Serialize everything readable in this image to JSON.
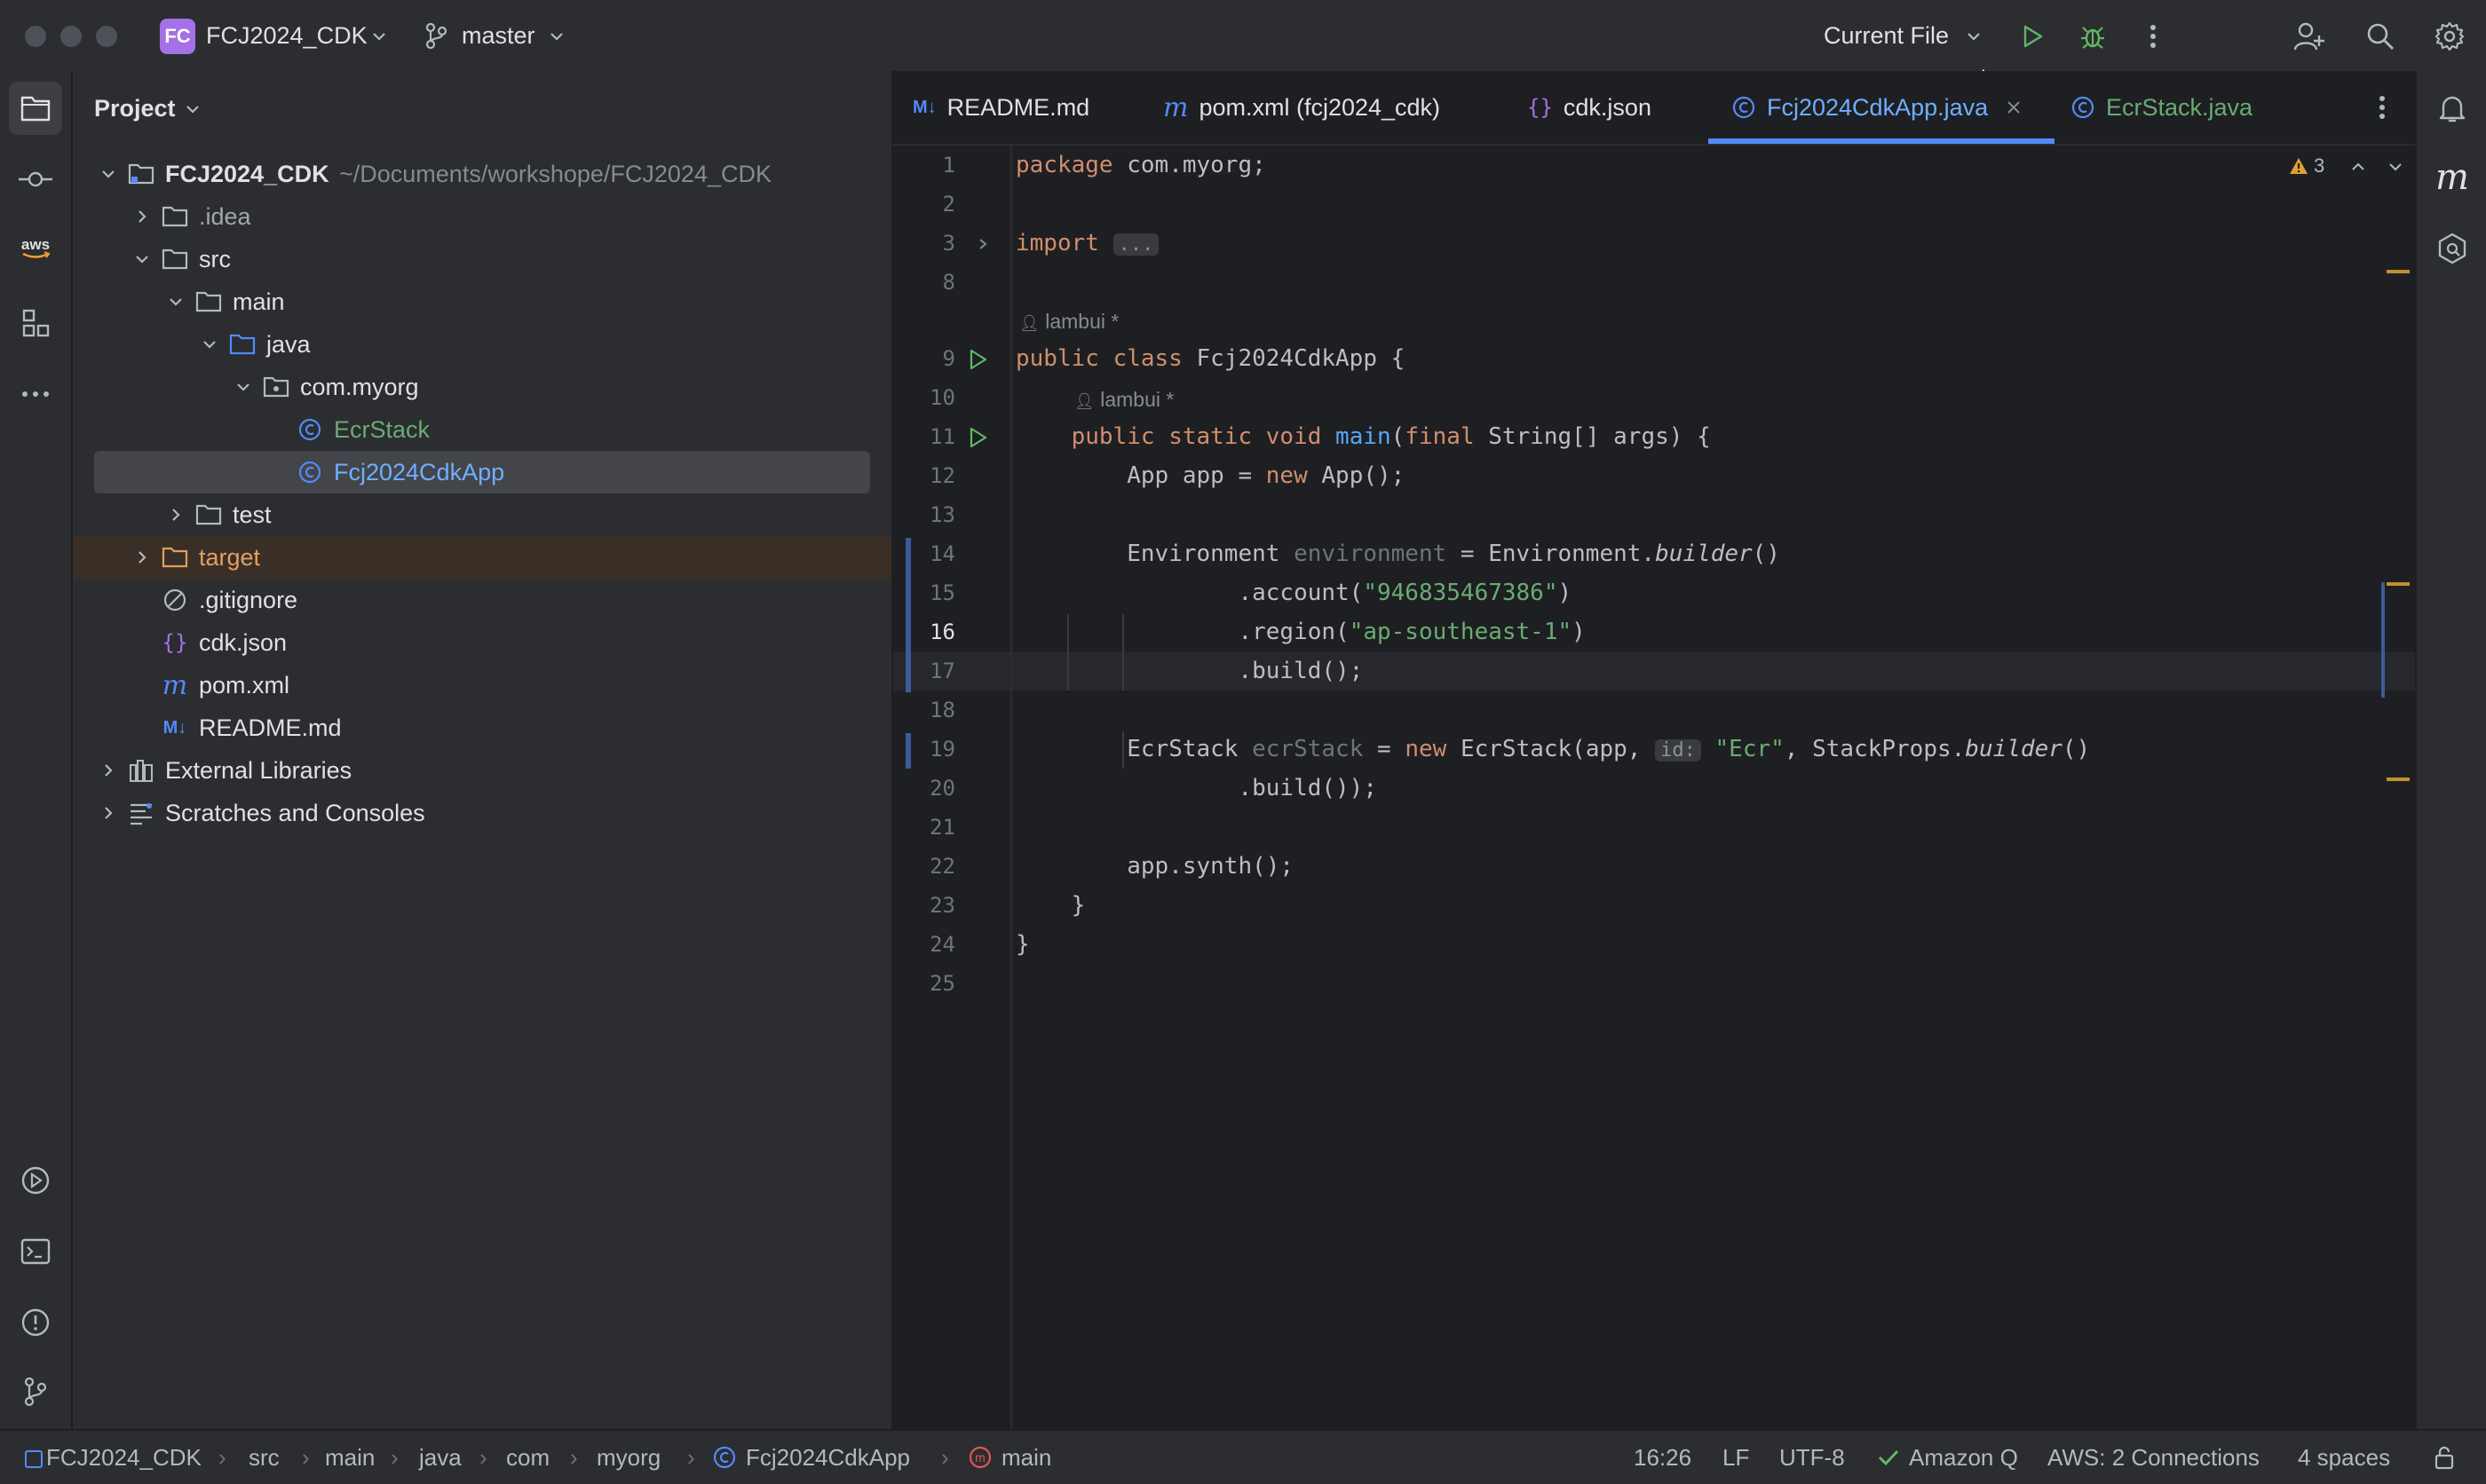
{
  "window": {
    "project_badge": "FC",
    "project_name": "FCJ2024_CDK",
    "branch": "master",
    "run_config": "Current File"
  },
  "project_panel": {
    "title": "Project",
    "tree": [
      {
        "label": "FCJ2024_CDK",
        "hint": "~/Documents/workshope/FCJ2024_CDK",
        "icon": "module-folder-icon"
      },
      {
        "label": ".idea",
        "icon": "folder-icon"
      },
      {
        "label": "src",
        "icon": "folder-icon"
      },
      {
        "label": "main",
        "icon": "folder-icon"
      },
      {
        "label": "java",
        "icon": "source-folder-icon"
      },
      {
        "label": "com.myorg",
        "icon": "package-icon"
      },
      {
        "label": "EcrStack",
        "icon": "java-class-icon"
      },
      {
        "label": "Fcj2024CdkApp",
        "icon": "java-class-icon"
      },
      {
        "label": "test",
        "icon": "folder-icon"
      },
      {
        "label": "target",
        "icon": "excluded-folder-icon"
      },
      {
        "label": ".gitignore",
        "icon": "ignore-file-icon"
      },
      {
        "label": "cdk.json",
        "icon": "json-file-icon"
      },
      {
        "label": "pom.xml",
        "icon": "maven-file-icon"
      },
      {
        "label": "README.md",
        "icon": "markdown-file-icon"
      },
      {
        "label": "External Libraries",
        "icon": "libraries-icon"
      },
      {
        "label": "Scratches and Consoles",
        "icon": "scratches-icon"
      }
    ]
  },
  "tabs": [
    {
      "label": "README.md",
      "icon_text": "M↓"
    },
    {
      "label": "pom.xml (fcj2024_cdk)",
      "icon_text": "m"
    },
    {
      "label": "cdk.json",
      "icon_text": "{}"
    },
    {
      "label": "Fcj2024CdkApp.java",
      "icon_text": "C"
    },
    {
      "label": "EcrStack.java",
      "icon_text": "C"
    }
  ],
  "editor": {
    "warnings_count": "3",
    "line_numbers": [
      "1",
      "2",
      "3",
      "8",
      "9",
      "10",
      "11",
      "12",
      "13",
      "14",
      "15",
      "16",
      "17",
      "18",
      "19",
      "20",
      "21",
      "22",
      "23",
      "24",
      "25"
    ],
    "author": "lambui *",
    "code": {
      "l1_kw": "package",
      "l1_rest": " com.myorg;",
      "l3_kw": "import",
      "l3_fold": "...",
      "l9_kw": "public class",
      "l9_rest": " Fcj2024CdkApp {",
      "l10_kw": "public static void",
      "l10_fn": "main",
      "l10_a": "(",
      "l10_final": "final",
      "l10_rest": " String[] args) {",
      "l11_a": "App app = ",
      "l11_new": "new",
      "l11_b": " App();",
      "l13_a": "Environment ",
      "l13_var": "environment",
      "l13_b": " = Environment.",
      "l13_c": "builder",
      "l13_d": "()",
      "l14_a": ".account(",
      "l14_str": "\"946835467386\"",
      "l14_b": ")",
      "l15_a": ".region(",
      "l15_str": "\"ap-southeast-1\"",
      "l15_b": ")",
      "l16": ".build();",
      "l18_a": "EcrStack ",
      "l18_var": "ecrStack",
      "l18_b": " = ",
      "l18_new": "new",
      "l18_c": " EcrStack(app, ",
      "l18_hint": "id:",
      "l18_str": "\"Ecr\"",
      "l18_d": ", StackProps.",
      "l18_e": "builder",
      "l18_f": "()",
      "l19": ".build());",
      "l21": "app.synth();",
      "l22": "}",
      "l23": "}"
    }
  },
  "breadcrumbs": [
    "FCJ2024_CDK",
    "src",
    "main",
    "java",
    "com",
    "myorg",
    "Fcj2024CdkApp",
    "main"
  ],
  "status": {
    "position": "16:26",
    "line_sep": "LF",
    "encoding": "UTF-8",
    "amazon_q": "Amazon Q",
    "aws": "AWS: 2 Connections",
    "indent": "4 spaces"
  },
  "colors": {
    "accent": "#548af7",
    "background": "#1e1f22",
    "panel": "#2b2d30",
    "keyword": "#cf8e6d",
    "string": "#6aab73",
    "function": "#56a8f5",
    "run_green": "#5fb865",
    "excluded": "#e0a060"
  }
}
